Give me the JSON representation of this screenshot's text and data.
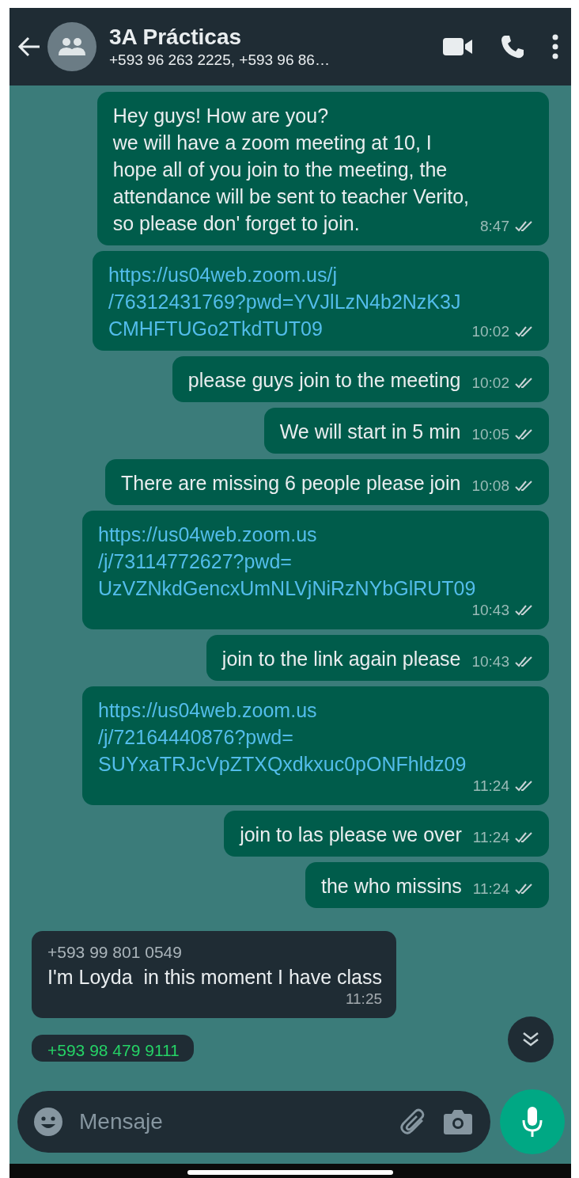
{
  "header": {
    "title": "3A Prácticas",
    "subtitle": "+593 96 263 2225, +593 96 86…"
  },
  "messages": [
    {
      "kind": "outgoing",
      "lines": [
        "Hey guys! How are you?",
        "we will have a zoom meeting at 10, I",
        "hope all of you join to the meeting, the",
        "attendance will be sent to teacher Verito,",
        "so please don' forget to join."
      ],
      "time": "8:47",
      "read": false
    },
    {
      "kind": "outgoing-link",
      "lines": [
        "https://us04web.zoom.us/j",
        "/76312431769?pwd=YVJlLzN4b2NzK3J",
        "CMHFTUGo2TkdTUT09"
      ],
      "time": "10:02",
      "read": false
    },
    {
      "kind": "outgoing",
      "lines": [
        "please guys join to the meeting"
      ],
      "time": "10:02",
      "read": false
    },
    {
      "kind": "outgoing",
      "lines": [
        "We will start in 5 min"
      ],
      "time": "10:05",
      "read": false
    },
    {
      "kind": "outgoing",
      "lines": [
        "There are missing 6 people please join"
      ],
      "time": "10:08",
      "read": false
    },
    {
      "kind": "outgoing-link",
      "lines": [
        "https://us04web.zoom.us",
        "/j/73114772627?pwd=",
        "UzVZNkdGencxUmNLVjNiRzNYbGlRUT09"
      ],
      "time": "10:43",
      "read": false
    },
    {
      "kind": "outgoing",
      "lines": [
        "join to the link again please"
      ],
      "time": "10:43",
      "read": false
    },
    {
      "kind": "outgoing-link",
      "lines": [
        "https://us04web.zoom.us",
        "/j/72164440876?pwd=",
        "SUYxaTRJcVpZTXQxdkxuc0pONFhldz09"
      ],
      "time": "11:24",
      "read": false
    },
    {
      "kind": "outgoing",
      "lines": [
        "join to las please we over"
      ],
      "time": "11:24",
      "read": false
    },
    {
      "kind": "outgoing",
      "lines": [
        "the who missins"
      ],
      "time": "11:24",
      "read": false
    },
    {
      "kind": "incoming",
      "sender": "+593 99 801 0549",
      "color": "#aab4ba",
      "lines": [
        "I'm Loyda  in this moment I have class"
      ],
      "time": "11:25"
    },
    {
      "kind": "incoming-partial",
      "sender": "+593 98 479 9111",
      "color": "#25d366"
    }
  ],
  "composer": {
    "placeholder": "Mensaje"
  }
}
